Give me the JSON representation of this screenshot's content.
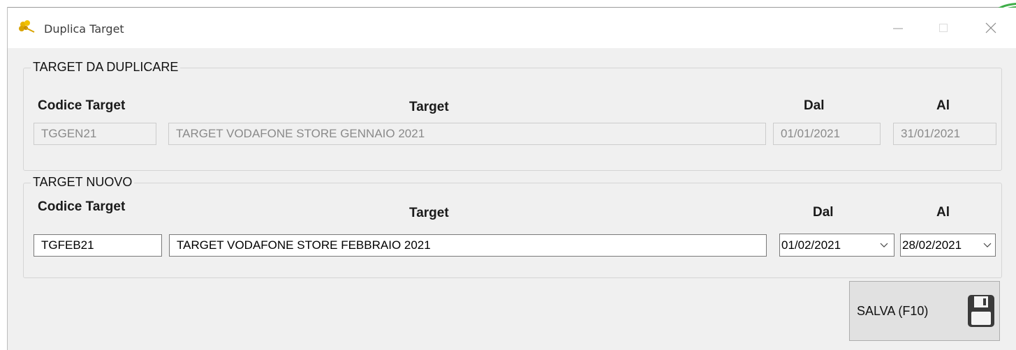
{
  "window": {
    "title": "Duplica Target",
    "icon": "app-flower-icon",
    "controls": [
      "minimize-icon",
      "maximize-icon",
      "close-icon"
    ]
  },
  "source": {
    "legend": "TARGET DA DUPLICARE",
    "headers": {
      "code": "Codice Target",
      "target": "Target",
      "from": "Dal",
      "to": "Al"
    },
    "code": "TGGEN21",
    "target": "TARGET VODAFONE STORE GENNAIO 2021",
    "from": "01/01/2021",
    "to": "31/01/2021"
  },
  "destination": {
    "legend": "TARGET NUOVO",
    "headers": {
      "code": "Codice Target",
      "target": "Target",
      "from": "Dal",
      "to": "Al"
    },
    "code": "TGFEB21",
    "target": "TARGET VODAFONE STORE FEBBRAIO 2021",
    "from": "01/02/2021",
    "to": "28/02/2021"
  },
  "actions": {
    "save_label": "SALVA (F10)",
    "save_icon": "floppy-disk-icon"
  },
  "colors": {
    "window_bg": "#f0f0f0",
    "titlebar_bg": "#ffffff",
    "accent_icon": "#e8b400",
    "corner_badge": "#3fae49"
  }
}
